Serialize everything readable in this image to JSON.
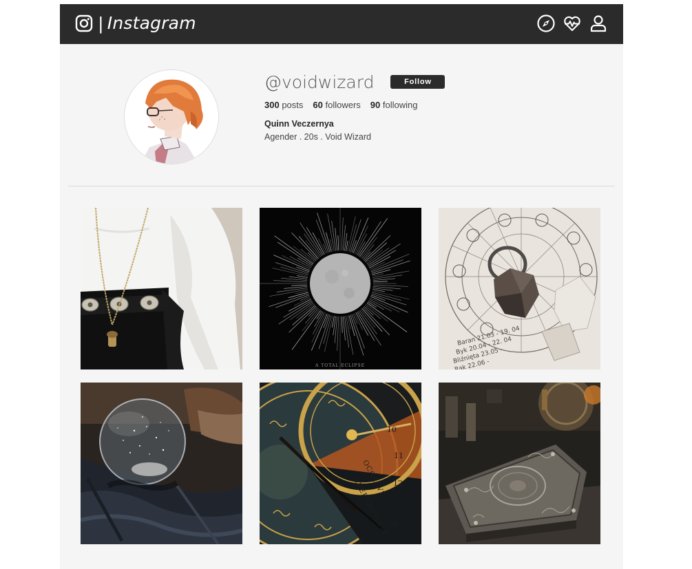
{
  "header": {
    "logo_icon": "instagram-camera-icon",
    "separator": "|",
    "brand": "Instagram",
    "nav_icons": [
      "compass-icon",
      "heart-pulse-icon",
      "user-icon"
    ]
  },
  "profile": {
    "handle": "@voidwizard",
    "follow_label": "Follow",
    "posts_count": "300",
    "posts_label": "posts",
    "followers_count": "60",
    "followers_label": "followers",
    "following_count": "90",
    "following_label": "following",
    "full_name": "Quinn Veczernya",
    "bio": "Agender . 20s . Void Wizard"
  },
  "posts": [
    {
      "subject": "white-shirt-necklace-photo"
    },
    {
      "subject": "eclipse-sun-photo",
      "caption": "A TOTAL ECLIPSE"
    },
    {
      "subject": "zodiac-ring-photo",
      "caption": "Baran 21.03 - 19. 04 · Byk 20.04 - 22. 05 · Bliźnięta 23.05 - ... · Rak 22.06 - ..."
    },
    {
      "subject": "crystal-ball-photo"
    },
    {
      "subject": "astronomical-clock-photo",
      "clock_words": [
        "OCCASVS",
        "CREPVSCVLVM"
      ],
      "clock_numerals": [
        "10",
        "11",
        "12",
        "III",
        "IV"
      ]
    },
    {
      "subject": "ornate-book-photo"
    }
  ],
  "colors": {
    "topbar": "#2b2b2b",
    "page_bg": "#f5f5f5",
    "follow_button": "#2b2b2b",
    "text": "#262626"
  }
}
